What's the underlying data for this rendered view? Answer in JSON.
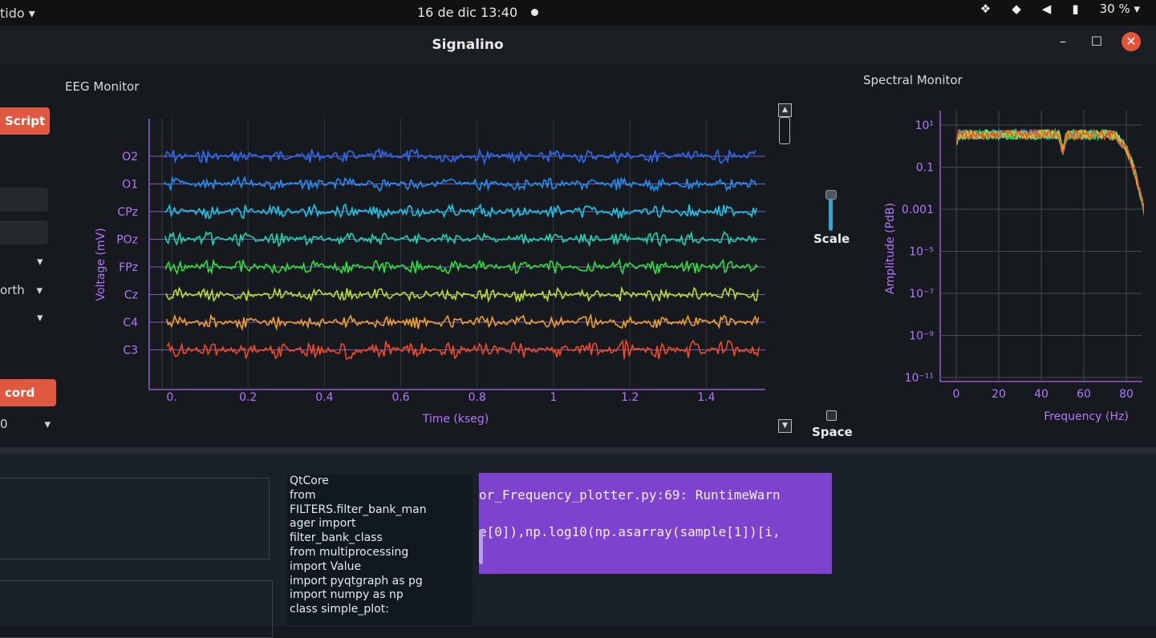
{
  "topbar": {
    "activities": "tido ▾",
    "clock": "16 de dic  13:40",
    "battery": "30 % ▾",
    "icons": [
      "dropbox-icon",
      "wifi-icon",
      "volume-icon",
      "battery-icon"
    ]
  },
  "window": {
    "title": "Signalino",
    "minimize": "–",
    "maximize": "☐",
    "close": "✕"
  },
  "left": {
    "script_button": "Script",
    "combo_filter": "orth",
    "record_button": "cord",
    "combo_bottom": "0"
  },
  "eeg": {
    "title": "EEG Monitor",
    "ylabel": "Voltage (mV)",
    "xlabel": "Time (kseg)",
    "channels": [
      "O2",
      "O1",
      "CPz",
      "POz",
      "FPz",
      "Cz",
      "C4",
      "C3"
    ],
    "colors": [
      "#2b6cf0",
      "#1f8ff0",
      "#1cc6e2",
      "#1ed4a6",
      "#2ee03a",
      "#b7de2c",
      "#f0a02c",
      "#f04a26"
    ],
    "xticks": [
      "0.",
      "0.2",
      "0.4",
      "0.6",
      "0.8",
      "1",
      "1.2",
      "1.4"
    ]
  },
  "controls": {
    "scale_label": "Scale",
    "space_label": "Space",
    "scale_value": 0.85
  },
  "spectral": {
    "title": "Spectral Monitor",
    "ylabel": "Amplitude (PdB)",
    "xlabel": "Frequency (Hz)",
    "yticks": [
      "10¹",
      "0.1",
      "0.001",
      "10⁻⁵",
      "10⁻⁷",
      "10⁻⁹",
      "10⁻¹¹"
    ],
    "xticks": [
      "0",
      "20",
      "40",
      "60",
      "80"
    ]
  },
  "code": {
    "lines": [
      "QtCore",
      "from",
      "FILTERS.filter_bank_man",
      "ager import",
      "filter_bank_class",
      "from multiprocessing",
      "import Value",
      "import pyqtgraph as pg",
      "import numpy as np",
      "",
      "class simple_plot:"
    ]
  },
  "console": {
    "lines": [
      "or_Frequency_plotter.py:69: RuntimeWarn",
      "e[0]),np.log10(np.asarray(sample[1])[i,"
    ]
  }
}
